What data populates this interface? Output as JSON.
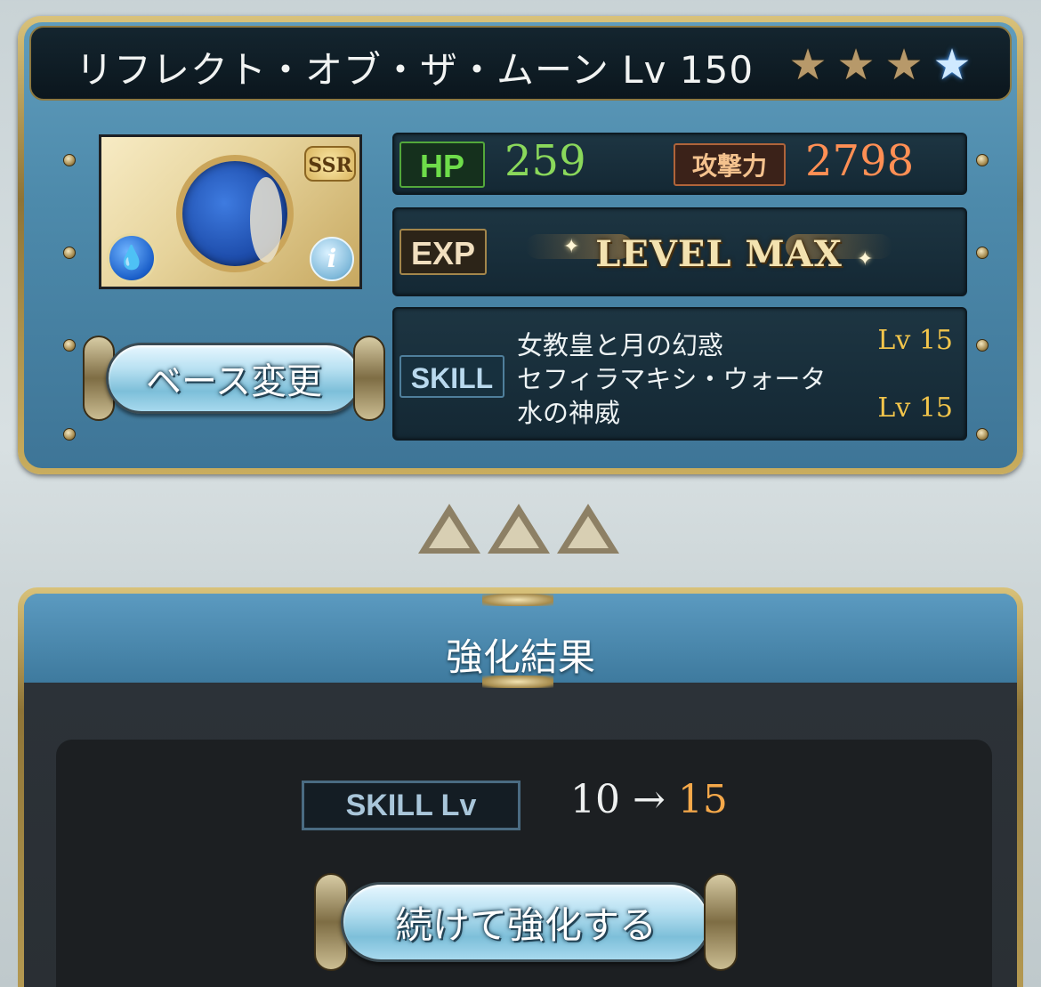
{
  "weapon": {
    "name": "リフレクト・オブ・ザ・ムーン",
    "level_label": "Lv 150",
    "stars": [
      "gold-star",
      "gold-star",
      "gold-star",
      "blue-star"
    ],
    "rarity": "SSR"
  },
  "stats": {
    "hp_label": "HP",
    "hp_value": "259",
    "atk_label": "攻撃力",
    "atk_value": "2798",
    "exp_label": "EXP",
    "exp_status": "LEVEL MAX"
  },
  "skills": {
    "label": "SKILL",
    "items": [
      {
        "name": "女教皇と月の幻惑",
        "level": "Lv 15"
      },
      {
        "name": "セフィラマキシ・ウォータ",
        "level": ""
      },
      {
        "name": "水の神威",
        "level": "Lv 15"
      }
    ]
  },
  "buttons": {
    "change_base": "ベース変更",
    "continue": "続けて強化する"
  },
  "result": {
    "title": "強化結果",
    "skill_lv_label": "SKILL Lv",
    "from": "10",
    "arrow": "→",
    "to": "15"
  },
  "icons": {
    "element": "water-element-icon",
    "info": "info-icon"
  },
  "colors": {
    "hp": "#8ad85b",
    "atk": "#ff8f54",
    "skill_level": "#f2c54b",
    "result_to": "#f5a84a"
  }
}
